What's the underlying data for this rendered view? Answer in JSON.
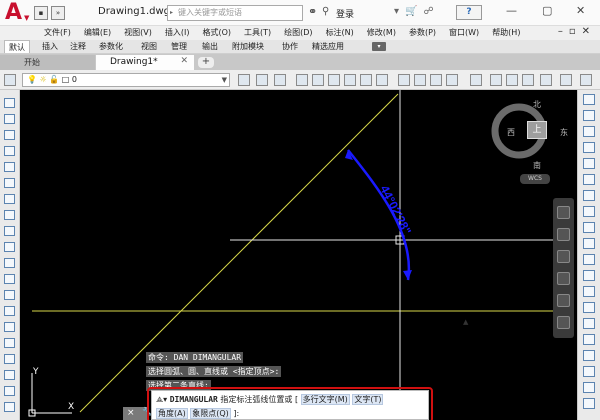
{
  "app": {
    "logo_letter": "A",
    "document_title": "Drawing1.dwg",
    "search_placeholder": "键入关键字或短语",
    "login_label": "登录",
    "help_label": "?"
  },
  "menu": {
    "items": [
      "文件(F)",
      "编辑(E)",
      "视图(V)",
      "插入(I)",
      "格式(O)",
      "工具(T)",
      "绘图(D)",
      "标注(N)",
      "修改(M)",
      "参数(P)",
      "窗口(W)",
      "帮助(H)"
    ]
  },
  "ribbon_tabs": [
    "默认",
    "插入",
    "注释",
    "参数化",
    "视图",
    "管理",
    "输出",
    "附加模块",
    "协作",
    "精选应用"
  ],
  "file_tabs": {
    "start": "开始",
    "doc": "Drawing1*",
    "add": "+"
  },
  "layer": {
    "current": "0"
  },
  "viewcube": {
    "north": "北",
    "south": "南",
    "west": "西",
    "east": "东",
    "top": "上",
    "wcs": "WCS"
  },
  "drawing": {
    "dimension_text": "44°02'28\"",
    "ucs_x": "X",
    "ucs_y": "Y",
    "colors": {
      "line": "#d8d84a",
      "crosshair": "#e6e6e6",
      "dimension": "#1a1aff"
    }
  },
  "command": {
    "history": [
      "命令: DAN DIMANGULAR",
      "选择圆弧、圆、直线或 <指定顶点>:",
      "选择第二条直线:"
    ],
    "cmd_name": "DIMANGULAR",
    "prompt": "指定标注弧线位置或 [",
    "opt_mtext": "多行文字(M)",
    "opt_text": "文字(T)",
    "opt_angle": "角度(A)",
    "opt_quadrant": "象限点(Q)",
    "end": "]:",
    "close": "×"
  }
}
